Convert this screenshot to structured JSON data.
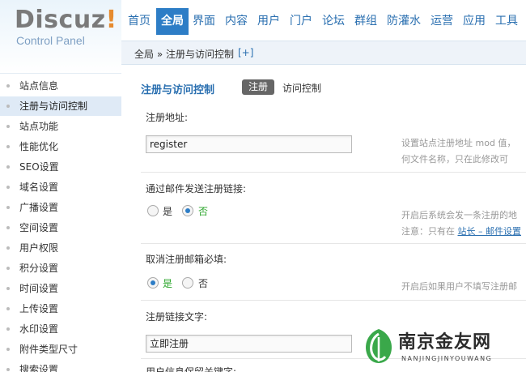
{
  "logo": {
    "main": "Discuz",
    "bang": "!",
    "sub": "Control Panel"
  },
  "topnav": [
    "首页",
    "全局",
    "界面",
    "内容",
    "用户",
    "门户",
    "论坛",
    "群组",
    "防灌水",
    "运营",
    "应用",
    "工具"
  ],
  "topnav_active": "全局",
  "breadcrumb": {
    "path": "全局 » 注册与访问控制",
    "plus": "[+]"
  },
  "sidebar": [
    "站点信息",
    "注册与访问控制",
    "站点功能",
    "性能优化",
    "SEO设置",
    "域名设置",
    "广播设置",
    "空间设置",
    "用户权限",
    "积分设置",
    "时间设置",
    "上传设置",
    "水印设置",
    "附件类型尺寸",
    "搜索设置"
  ],
  "sidebar_active": "注册与访问控制",
  "main": {
    "title": "注册与访问控制",
    "tab_active": "注册",
    "tab_other": "访问控制",
    "rows": {
      "r1_label": "注册地址:",
      "r1_value": "register",
      "r1_desc1": "设置站点注册地址 mod 值，",
      "r1_desc2": "何文件名称，只在此修改可",
      "r2_label": "通过邮件发送注册链接:",
      "r2_yes": "是",
      "r2_no": "否",
      "r2_desc1": "开启后系统会发一条注册的地",
      "r2_desc2_prefix": "注意：只有在 ",
      "r2_desc2_link": "站长 – 邮件设置",
      "r3_label": "取消注册邮箱必填:",
      "r3_yes": "是",
      "r3_no": "否",
      "r3_desc": "开启后如果用户不填写注册邮",
      "r4_label": "注册链接文字:",
      "r4_value": "立即注册",
      "r5_label": "用户信息保留关键字:"
    }
  },
  "watermark": {
    "title": "南京金友网",
    "sub": "NANJINGJINYOUWANG"
  },
  "colors": {
    "accent": "#2d7dc6",
    "link": "#2a6fb0",
    "selected_green": "#2aa52a"
  }
}
